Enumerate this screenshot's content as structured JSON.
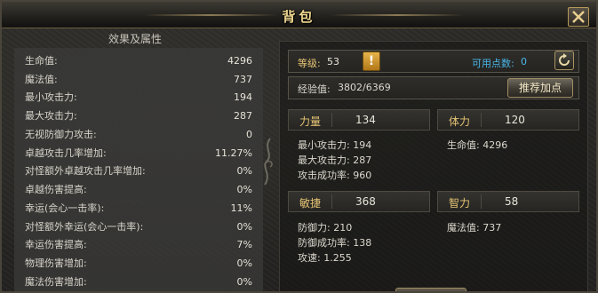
{
  "window": {
    "title": "背包"
  },
  "left_panel": {
    "header": "效果及属性",
    "stats": [
      {
        "label": "生命值:",
        "value": "4296"
      },
      {
        "label": "魔法值:",
        "value": "737"
      },
      {
        "label": "最小攻击力:",
        "value": "194"
      },
      {
        "label": "最大攻击力:",
        "value": "287"
      },
      {
        "label": "无视防御力攻击:",
        "value": "0"
      },
      {
        "label": "卓越攻击几率增加:",
        "value": "11.27%"
      },
      {
        "label": "对怪额外卓越攻击几率增加:",
        "value": "0%"
      },
      {
        "label": "卓越伤害提高:",
        "value": "0%"
      },
      {
        "label": "幸运(会心一击率):",
        "value": "11%"
      },
      {
        "label": "对怪额外幸运(会心一击率):",
        "value": "0%"
      },
      {
        "label": "幸运伤害提高:",
        "value": "7%"
      },
      {
        "label": "物理伤害增加:",
        "value": "0%"
      },
      {
        "label": "魔法伤害增加:",
        "value": "0%"
      }
    ]
  },
  "right_panel": {
    "level_label": "等级:",
    "level_value": "53",
    "warn_icon": "!",
    "points_label": "可用点数:",
    "points_value": "0",
    "exp_label": "经验值:",
    "exp_value": "3802/6369",
    "recommend_label": "推荐加点",
    "attributes": {
      "strength": {
        "name": "力量",
        "value": "134",
        "details": [
          "最小攻击力: 194",
          "最大攻击力: 287",
          "攻击成功率: 960"
        ]
      },
      "stamina": {
        "name": "体力",
        "value": "120",
        "details": [
          "生命值: 4296"
        ]
      },
      "agility": {
        "name": "敏捷",
        "value": "368",
        "details": [
          "防御力: 210",
          "防御成功率: 138",
          "攻速: 1.255"
        ]
      },
      "energy": {
        "name": "智力",
        "value": "58",
        "details": [
          "魔法值: 737"
        ]
      }
    }
  },
  "colors": {
    "title_gold": "#f0d890",
    "label_gold": "#e6c474",
    "label_cyan": "#49b6e8",
    "panel_bg": "#3a3a38"
  },
  "icons": {
    "close": "close-icon",
    "reset": "refresh-icon",
    "warn": "exclamation-icon"
  }
}
